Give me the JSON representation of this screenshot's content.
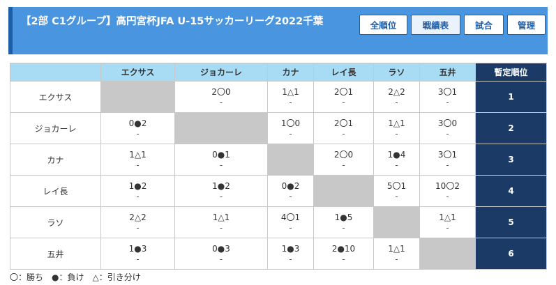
{
  "header": {
    "title": "【2部 C1グループ】高円宮杯JFA U-15サッカーリーグ2022千葉",
    "buttons": [
      "全順位",
      "戦績表",
      "試合",
      "管理"
    ]
  },
  "table": {
    "corner": "",
    "columns": [
      "エクサス",
      "ジョカーレ",
      "カナ",
      "レイ長",
      "ラソ",
      "五井"
    ],
    "rank_header": "暫定順位",
    "rows": [
      {
        "team": "エクサス",
        "results": [
          null,
          "2〇0",
          "1△1",
          "2〇1",
          "2△2",
          "3〇1"
        ],
        "subs": [
          null,
          "-",
          "-",
          "-",
          "-",
          "-"
        ],
        "rank": "1"
      },
      {
        "team": "ジョカーレ",
        "results": [
          "0●2",
          null,
          "1〇0",
          "2〇1",
          "1△1",
          "3〇0"
        ],
        "subs": [
          "-",
          null,
          "-",
          "-",
          "-",
          "-"
        ],
        "rank": "2"
      },
      {
        "team": "カナ",
        "results": [
          "1△1",
          "0●1",
          null,
          "2〇0",
          "1●4",
          "3〇1"
        ],
        "subs": [
          "-",
          "-",
          null,
          "-",
          "-",
          "-"
        ],
        "rank": "3"
      },
      {
        "team": "レイ長",
        "results": [
          "1●2",
          "1●2",
          "0●2",
          null,
          "5〇1",
          "10〇2"
        ],
        "subs": [
          "-",
          "-",
          "-",
          null,
          "-",
          "-"
        ],
        "rank": "4"
      },
      {
        "team": "ラソ",
        "results": [
          "2△2",
          "1△1",
          "4〇1",
          "1●5",
          null,
          "1△1"
        ],
        "subs": [
          "-",
          "-",
          "-",
          "-",
          null,
          "-"
        ],
        "rank": "5"
      },
      {
        "team": "五井",
        "results": [
          "1●3",
          "0●3",
          "1●3",
          "2●10",
          "1△1",
          null
        ],
        "subs": [
          "-",
          "-",
          "-",
          "-",
          "-",
          null
        ],
        "rank": "6"
      }
    ]
  },
  "legend": "〇：勝ち　●：負け　△：引き分け"
}
